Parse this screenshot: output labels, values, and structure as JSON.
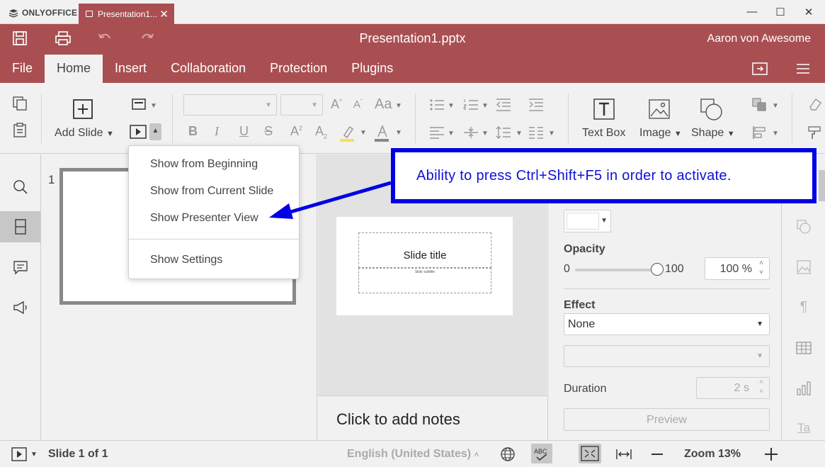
{
  "app": {
    "brand": "ONLYOFFICE",
    "tab_title": "Presentation1...",
    "doc_title": "Presentation1.pptx",
    "user": "Aaron von Awesome",
    "accent_color": "#a94f52"
  },
  "menu_tabs": [
    "File",
    "Home",
    "Insert",
    "Collaboration",
    "Protection",
    "Plugins"
  ],
  "active_tab": "Home",
  "toolbar": {
    "add_slide": "Add Slide",
    "text_box": "Text Box",
    "image": "Image",
    "shape": "Shape"
  },
  "slideshow_menu": {
    "items": [
      "Show from Beginning",
      "Show from Current Slide",
      "Show Presenter View",
      "Show Settings"
    ]
  },
  "slides_panel": {
    "slide_number": "1"
  },
  "slide": {
    "title_placeholder": "Slide title",
    "subtitle_placeholder": "Slide subtitle"
  },
  "notes": {
    "placeholder": "Click to add notes"
  },
  "right_panel": {
    "opacity_label": "Opacity",
    "opacity_min": "0",
    "opacity_max": "100",
    "opacity_value": "100 %",
    "opacity_level": 1.0,
    "effect_label": "Effect",
    "effect_value": "None",
    "duration_label": "Duration",
    "duration_value": "2 s",
    "preview_label": "Preview"
  },
  "statusbar": {
    "slide_counter": "Slide 1 of 1",
    "language": "English (United States)",
    "zoom": "Zoom 13%"
  },
  "annotation": {
    "text": "Ability to press Ctrl+Shift+F5 in order to activate.",
    "color": "#0000e6"
  }
}
